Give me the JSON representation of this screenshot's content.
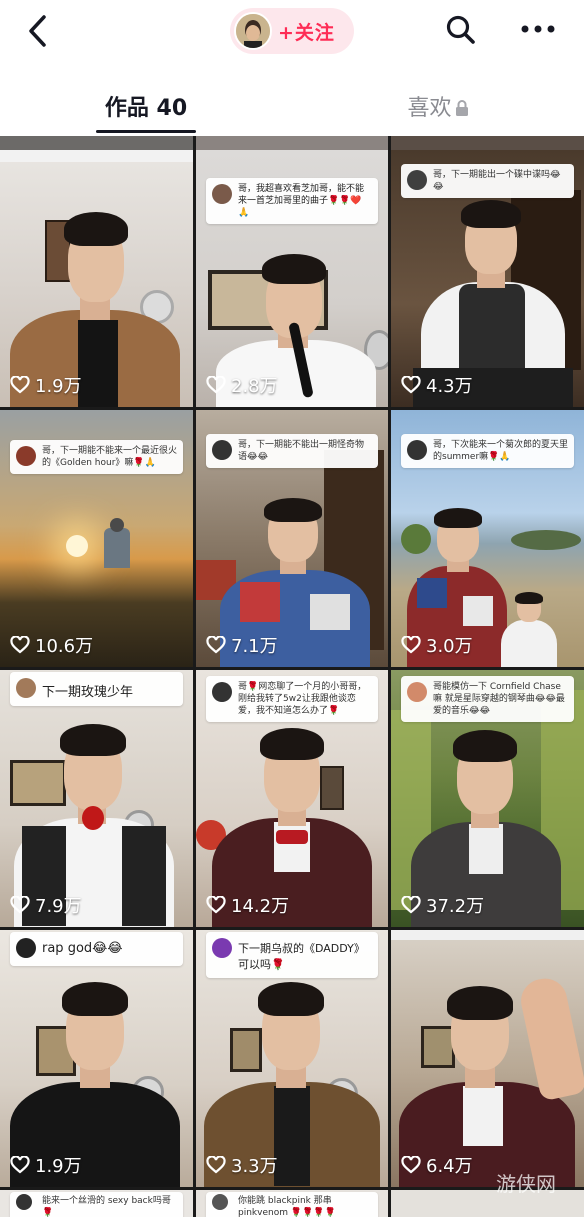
{
  "header": {
    "back_icon": "chevron-left-icon",
    "follow_label": "+关注",
    "search_icon": "search-icon",
    "more_icon": "more-dots-icon",
    "accent_color": "#fe2c55"
  },
  "tabs": {
    "works_label": "作品 40",
    "likes_label": "喜欢",
    "likes_icon": "lock-icon"
  },
  "videos": [
    {
      "likes": "1.9万",
      "comment_user": "",
      "comment_text": ""
    },
    {
      "likes": "2.8万",
      "comment_user": "",
      "comment_text": "哥，我超喜欢看芝加哥，能不能来一首芝加哥里的曲子🌹🌹❤️🙏"
    },
    {
      "likes": "4.3万",
      "comment_user": "",
      "comment_text": "哥，下一期能出一个碟中谍吗😂😂"
    },
    {
      "likes": "10.6万",
      "comment_user": "",
      "comment_text": "哥，下一期能不能来一个最近很火的《Golden hour》嘛🌹🙏"
    },
    {
      "likes": "7.1万",
      "comment_user": "",
      "comment_text": "哥，下一期能不能出一期怪奇物语😂😂"
    },
    {
      "likes": "3.0万",
      "comment_user": "",
      "comment_text": "哥，下次能来一个菊次郎的夏天里的summer嘛🌹🙏"
    },
    {
      "likes": "7.9万",
      "comment_user": "",
      "comment_text": "下一期玫瑰少年"
    },
    {
      "likes": "14.2万",
      "comment_user": "",
      "comment_text": "哥🌹网恋聊了一个月的小哥哥，刚给我转了5w2让我跟他谈恋爱，我不知道怎么办了🌹"
    },
    {
      "likes": "37.2万",
      "comment_user": "",
      "comment_text": "哥能模仿一下 Cornfield Chase嘛 就是星际穿越的钢琴曲😂😂最爱的音乐😂😂"
    },
    {
      "likes": "1.9万",
      "comment_user": "",
      "comment_text": "rap god😂😂"
    },
    {
      "likes": "3.3万",
      "comment_user": "",
      "comment_text": "下一期乌叔的《DADDY》可以吗🌹"
    },
    {
      "likes": "6.4万",
      "comment_user": "",
      "comment_text": ""
    }
  ],
  "bottom_row": [
    {
      "comment_text": "能来一个丝滑的 sexy back吗哥🌹"
    },
    {
      "comment_text": "你能跳 blackpink 那串 pinkvenom 🌹🌹🌹🌹"
    },
    {
      "comment_text": ""
    }
  ],
  "watermark": "游侠网"
}
